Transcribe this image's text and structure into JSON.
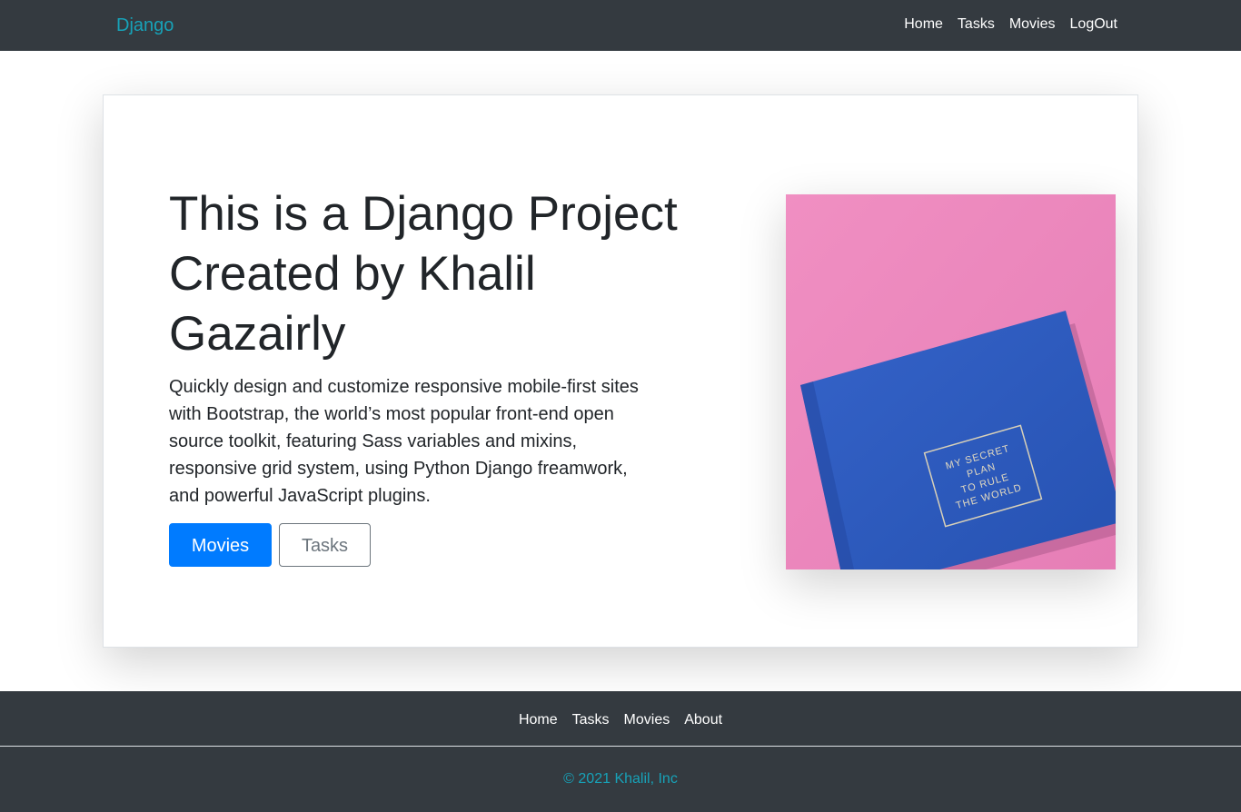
{
  "navbar": {
    "brand": "Django",
    "links": [
      "Home",
      "Tasks",
      "Movies",
      "LogOut"
    ]
  },
  "hero": {
    "title": "This is a Django Project Created by Khalil Gazairly",
    "lead": "Quickly design and customize responsive mobile-first sites with Bootstrap, the world’s most popular front-end open source toolkit, featuring Sass variables and mixins, responsive grid system, using Python Django freamwork, and powerful JavaScript plugins.",
    "primary_button": "Movies",
    "secondary_button": "Tasks",
    "image_text": [
      "MY SECRET",
      "PLAN",
      "TO RULE",
      "THE WORLD"
    ]
  },
  "footer": {
    "links": [
      "Home",
      "Tasks",
      "Movies",
      "About"
    ],
    "copyright": "© 2021 Khalil, Inc"
  },
  "colors": {
    "navbar_bg": "#343a40",
    "brand": "#17a2b8",
    "primary": "#007bff",
    "secondary": "#6c757d",
    "image_background": "#ee8fbf",
    "book_cover": "#2d5bc0"
  }
}
